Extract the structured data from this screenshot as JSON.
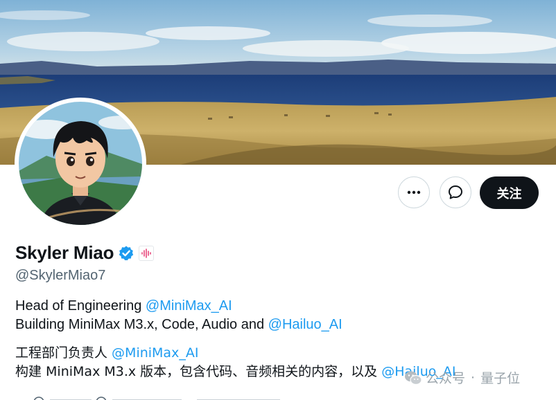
{
  "profile": {
    "name": "Skyler Miao",
    "handle": "@SkylerMiao7",
    "follow_label": "关注",
    "bio": {
      "line1_text": "Head of Engineering ",
      "line1_mention": "@MiniMax_AI",
      "line2_text": "Building MiniMax M3.x, Code, Audio and ",
      "line2_mention": "@Hailuo_AI",
      "line3_text": "工程部门负责人 ",
      "line3_mention": "@MiniMax_AI",
      "line4_text": "构建 MiniMax M3.x 版本，包含代码、音频相关的内容，以及 ",
      "line4_mention": "@Hailuo_AI"
    }
  },
  "watermark": {
    "source": "公众号",
    "separator": "·",
    "brand": "量子位"
  },
  "colors": {
    "accent": "#1d9bf0",
    "text": "#0f1419",
    "muted": "#536471",
    "button_dark": "#0f1419"
  },
  "icons": [
    "more-icon",
    "message-icon",
    "verified-icon",
    "affiliate-icon",
    "wechat-icon"
  ]
}
